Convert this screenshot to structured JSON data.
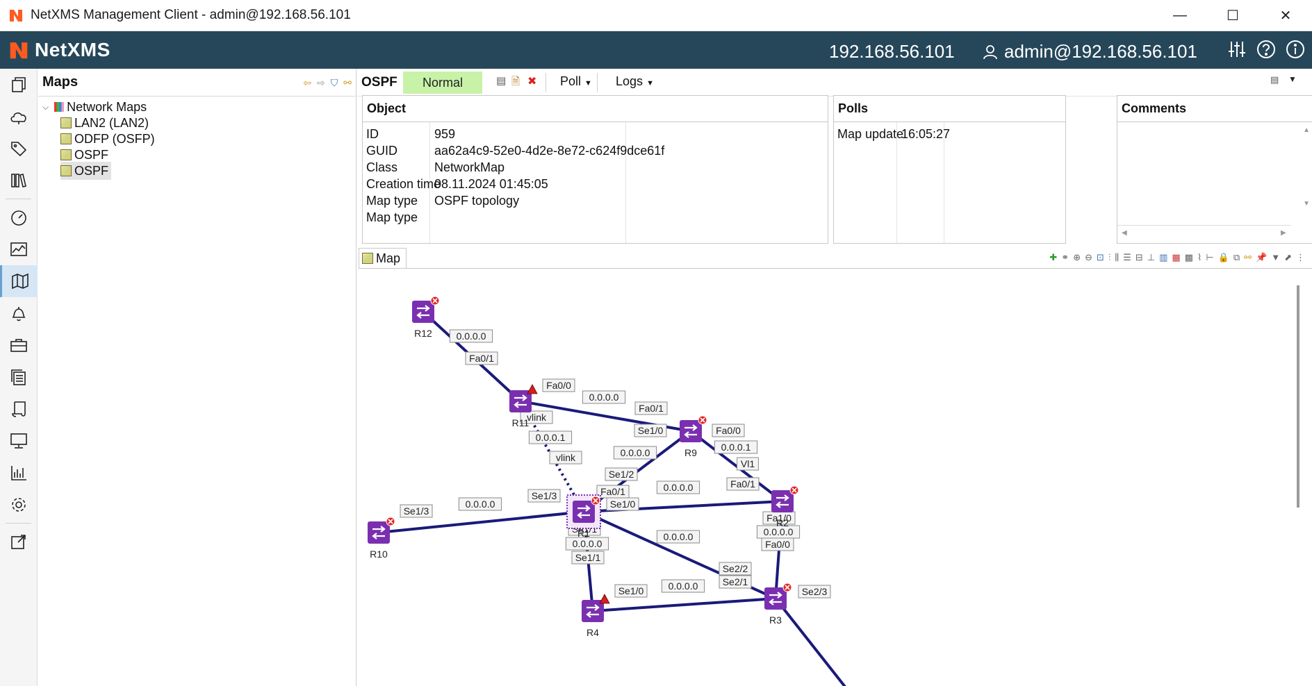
{
  "window": {
    "title": "NetXMS Management Client - admin@192.168.56.101"
  },
  "header": {
    "brand": "NetXMS",
    "server": "192.168.56.101",
    "user": "admin@192.168.56.101"
  },
  "rail": {
    "icons": [
      "objects-icon",
      "cloud-icon",
      "tags-icon",
      "library-icon",
      "dashboard-icon",
      "graph-icon",
      "maps-icon",
      "alarm-bell-icon",
      "toolbox-icon",
      "documents-icon",
      "scripts-icon",
      "monitor-icon",
      "reports-icon",
      "settings-icon",
      "export-icon"
    ]
  },
  "tree": {
    "title": "Maps",
    "root": "Network Maps",
    "items": [
      "LAN2 (LAN2)",
      "ODFP (OSFP)",
      "OSPF",
      "OSPF"
    ]
  },
  "object": {
    "name": "OSPF",
    "status": "Normal",
    "poll_menu": "Poll",
    "logs_menu": "Logs"
  },
  "object_box": {
    "title": "Object",
    "rows": [
      {
        "key": "ID",
        "value": "959"
      },
      {
        "key": "GUID",
        "value": "aa62a4c9-52e0-4d2e-8e72-c624f9dce61f"
      },
      {
        "key": "Class",
        "value": "NetworkMap"
      },
      {
        "key": "Creation time",
        "value": "08.11.2024 01:45:05"
      },
      {
        "key": "Map type",
        "value": "OSPF topology"
      },
      {
        "key": "Map type",
        "value": ""
      }
    ]
  },
  "polls_box": {
    "title": "Polls",
    "rows": [
      {
        "key": "Map update",
        "value": "16:05:27"
      }
    ]
  },
  "comments_box": {
    "title": "Comments"
  },
  "map": {
    "tab_label": "Map",
    "nodes": [
      {
        "id": "R12",
        "label": "R12",
        "status": "critical"
      },
      {
        "id": "R11",
        "label": "R11",
        "status": "major"
      },
      {
        "id": "R9",
        "label": "R9",
        "status": "critical"
      },
      {
        "id": "R1",
        "label": "R1",
        "status": "critical"
      },
      {
        "id": "R2",
        "label": "R2",
        "status": "critical"
      },
      {
        "id": "R10",
        "label": "R10",
        "status": "critical"
      },
      {
        "id": "R4",
        "label": "R4",
        "status": "major"
      },
      {
        "id": "R3",
        "label": "R3",
        "status": "critical"
      }
    ],
    "link_labels": [
      "0.0.0.0",
      "Fa0/1",
      "Fa0/0",
      "0.0.0.0",
      "Fa0/1",
      "vlink",
      "0.0.0.1",
      "vlink",
      "Se1/0",
      "0.0.0.0",
      "Se1/2",
      "Fa0/0",
      "0.0.0.1",
      "Vl1",
      "Fa0/1",
      "0.0.0.0",
      "Fa0/1",
      "Se1/0",
      "Se1/3",
      "0.0.0.0",
      "Se1/3",
      "Se1/1",
      "0.0.0.0",
      "Se1/1",
      "0.0.0.0",
      "Fa1/0",
      "0.0.0.0",
      "Fa0/0",
      "Se2/2",
      "Se2/1",
      "Se1/0",
      "0.0.0.0",
      "Se2/3"
    ]
  },
  "colors": {
    "header_bg": "#26475a",
    "status_normal": "#c8f2a8",
    "link": "#1a1a7a",
    "node": "#7a2fb0"
  }
}
